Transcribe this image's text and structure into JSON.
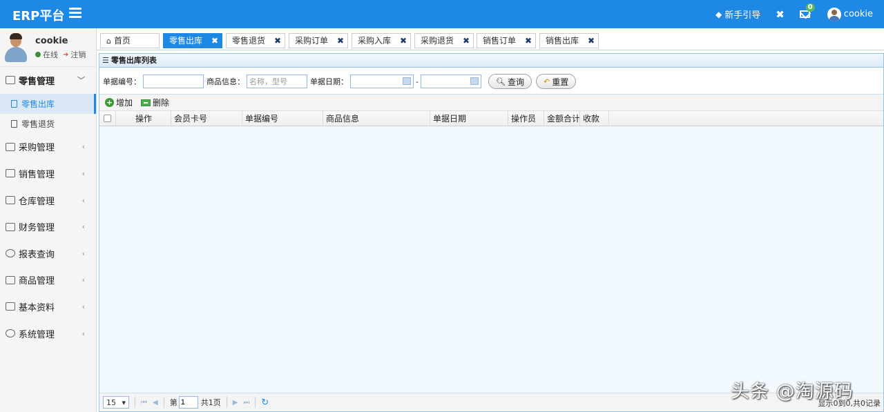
{
  "header": {
    "brand": "ERP平台",
    "guide": "新手引导",
    "mail_count": "0",
    "username": "cookie"
  },
  "profile": {
    "name": "cookie",
    "status": "在线",
    "logout": "注销"
  },
  "sidebar": {
    "groups": [
      {
        "label": "零售管理",
        "open": true
      },
      {
        "label": "采购管理"
      },
      {
        "label": "销售管理"
      },
      {
        "label": "仓库管理"
      },
      {
        "label": "财务管理"
      },
      {
        "label": "报表查询"
      },
      {
        "label": "商品管理"
      },
      {
        "label": "基本资料"
      },
      {
        "label": "系统管理"
      }
    ],
    "subitems": [
      {
        "label": "零售出库",
        "active": true
      },
      {
        "label": "零售退货"
      }
    ]
  },
  "tabs": [
    {
      "label": "首页"
    },
    {
      "label": "零售出库",
      "active": true
    },
    {
      "label": "零售退货"
    },
    {
      "label": "采购订单"
    },
    {
      "label": "采购入库"
    },
    {
      "label": "采购退货"
    },
    {
      "label": "销售订单"
    },
    {
      "label": "销售出库"
    }
  ],
  "panel": {
    "title": "零售出库列表"
  },
  "search": {
    "doc_no_label": "单据编号：",
    "doc_no_value": "",
    "goods_label": "商品信息：",
    "goods_placeholder": "名称，型号",
    "date_label": "单据日期：",
    "date_sep": "-",
    "query_button": "查询",
    "reset_button": "重置"
  },
  "toolbar": {
    "add": "增加",
    "delete": "删除"
  },
  "grid": {
    "columns": [
      "操作",
      "会员卡号",
      "单据编号",
      "商品信息",
      "单据日期",
      "操作员",
      "金额合计",
      "收款"
    ],
    "rows": []
  },
  "pager": {
    "page_size": "15",
    "page_prefix": "第",
    "page_value": "1",
    "page_total": "共1页",
    "info": "显示0到0,共0记录"
  },
  "watermark": "头条 @淘源码"
}
